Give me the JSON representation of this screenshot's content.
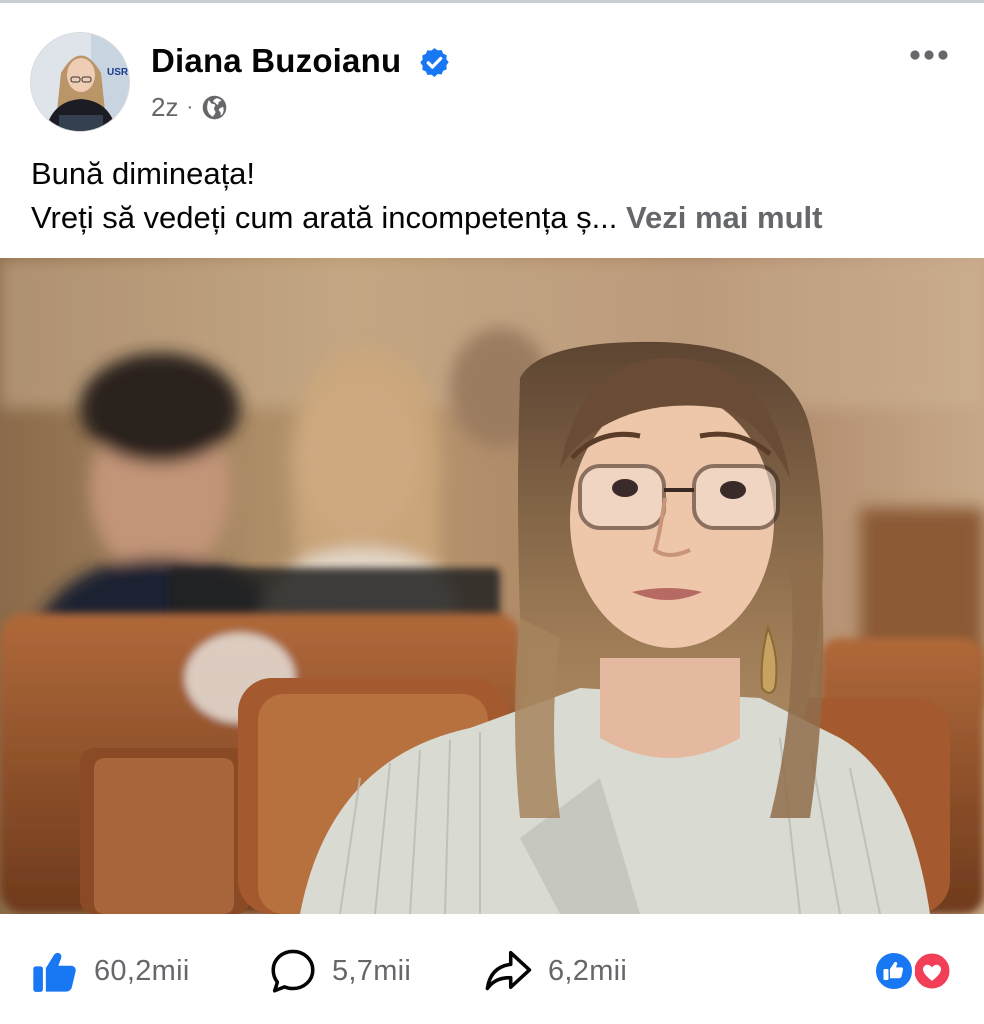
{
  "post": {
    "author": {
      "name": "Diana Buzoianu",
      "verified_icon": "verified-badge-icon",
      "avatar_badge_text": "USR"
    },
    "time_ago": "2z",
    "separator": "·",
    "audience_icon": "globe-icon",
    "more_icon": "more-options-icon",
    "text": {
      "line1": "Bună dimineața!",
      "line2": "Vreți să vedeți cum arată incompetența ș...",
      "see_more": "Vezi mai mult"
    },
    "photo": {
      "subject": "woman-with-glasses-in-parliament-photo"
    },
    "actions": {
      "like_count": "60,2mii",
      "comment_count": "5,7mii",
      "share_count": "6,2mii"
    },
    "reactions": [
      "like-reaction-icon",
      "love-reaction-icon"
    ],
    "colors": {
      "brand_blue": "#1877f2",
      "secondary_text": "#65676b",
      "love_red": "#f33e58"
    }
  }
}
